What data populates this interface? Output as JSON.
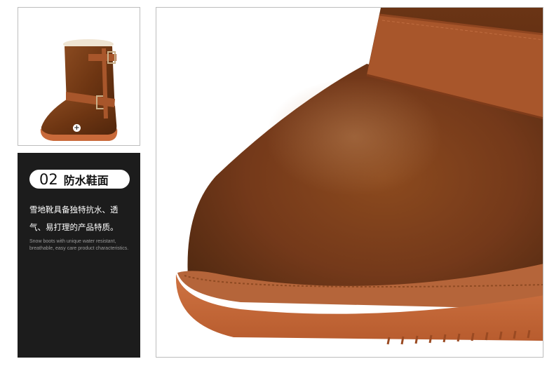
{
  "feature": {
    "number": "02",
    "title": "防水鞋面",
    "description_cn_line1": "雪地靴具备独特抗水、透",
    "description_cn_line2": "气、易打理的产品特质。",
    "description_en": "Snow boots with unique water resistant, breathable, easy care product characteristics."
  },
  "thumbnail": {
    "marker_symbol": "+"
  },
  "colors": {
    "panel_bg": "#1c1c1c",
    "pill_bg": "#ffffff",
    "leather": "#7a3e17",
    "strap": "#a8562b",
    "sole": "#c96a3a"
  }
}
